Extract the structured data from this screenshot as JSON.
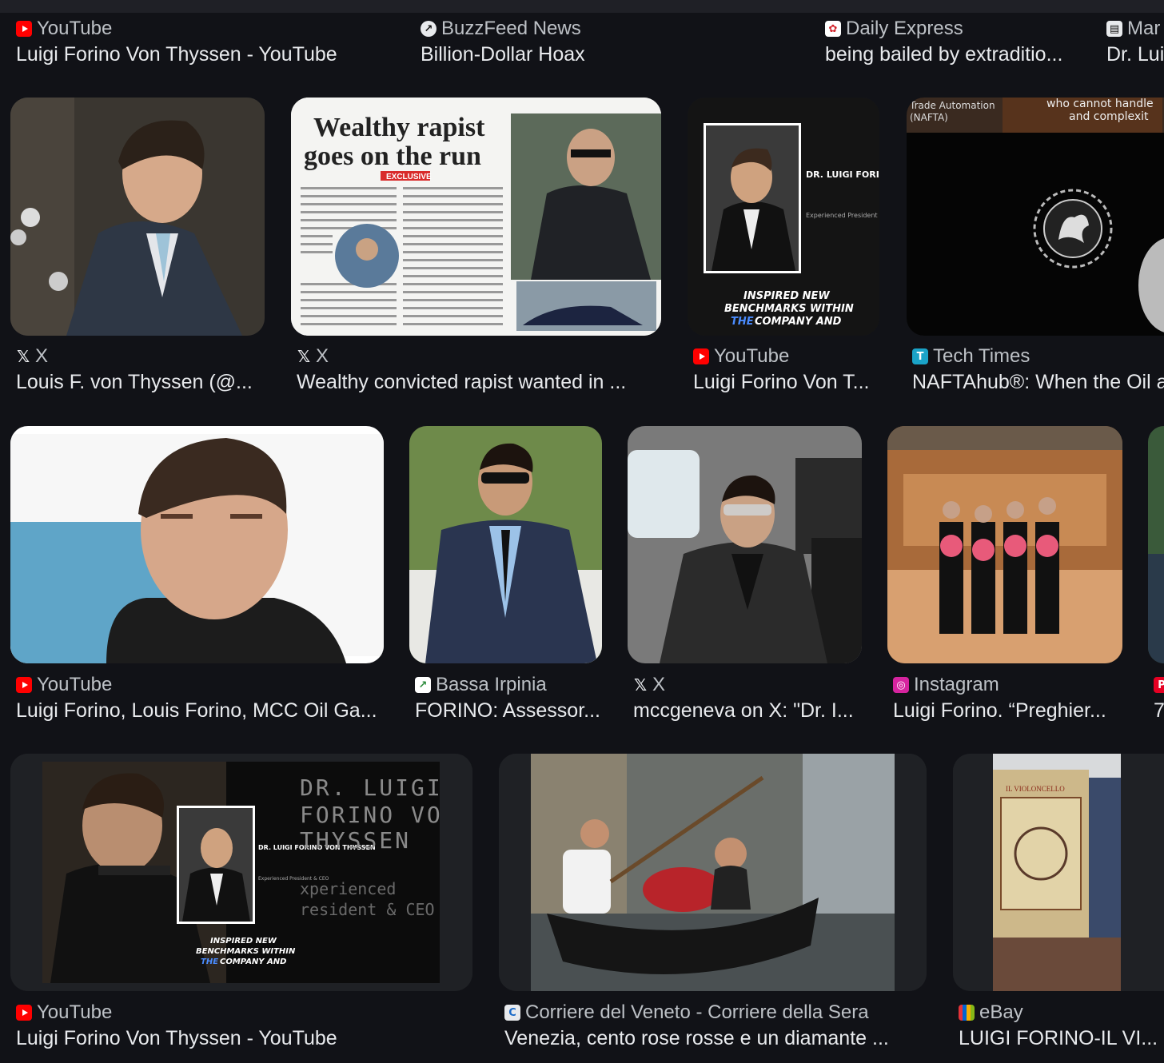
{
  "results": [
    {
      "source": "YouTube",
      "title": "Luigi Forino Von Thyssen - YouTube",
      "icon": "youtube-icon"
    },
    {
      "source": "BuzzFeed News",
      "title": "Billion-Dollar Hoax",
      "icon": "buzzfeed-icon"
    },
    {
      "source": "Daily Express",
      "title": "being bailed by extraditio...",
      "icon": "daily-express-icon"
    },
    {
      "source": "Mar",
      "title": "Dr. Lui",
      "icon": "newspaper-icon"
    },
    {
      "source": "X",
      "title": "Louis F. von Thyssen (@...",
      "icon": "x-icon"
    },
    {
      "source": "X",
      "title": "Wealthy convicted rapist wanted in ...",
      "icon": "x-icon",
      "image_text": {
        "headline1": "Wealthy rapist",
        "headline2": "goes on the run",
        "label": "EXCLUSIVE"
      }
    },
    {
      "source": "YouTube",
      "title": "Luigi Forino Von T...",
      "icon": "youtube-icon",
      "image_text": {
        "name": "DR. LUIGI FORINO VON THYSSEN",
        "role": "Experienced President & CEO",
        "tag1": "INSPIRED NEW",
        "tag2": "BENCHMARKS WITHIN",
        "tag3a": "THE",
        "tag3b": "COMPANY AND"
      }
    },
    {
      "source": "Tech Times",
      "title": "NAFTAhub®: When the Oil a",
      "icon": "tech-times-icon",
      "image_text": {
        "left": "Trade Automation",
        "left2": "(NAFTA)",
        "right": "who cannot handle",
        "right2": "and complexit"
      }
    },
    {
      "source": "YouTube",
      "title": "Luigi Forino, Louis Forino, MCC Oil Ga...",
      "icon": "youtube-icon"
    },
    {
      "source": "Bassa Irpinia",
      "title": "FORINO: Assessor...",
      "icon": "bassa-irpinia-icon"
    },
    {
      "source": "X",
      "title": "mccgeneva on X: \"Dr. I...",
      "icon": "x-icon"
    },
    {
      "source": "Instagram",
      "title": "Luigi Forino. “Preghier...",
      "icon": "instagram-icon"
    },
    {
      "source": "",
      "title": "7",
      "icon": "pinterest-icon"
    },
    {
      "source": "YouTube",
      "title": "Luigi Forino Von Thyssen - YouTube",
      "icon": "youtube-icon",
      "image_text": {
        "big1": "DR. LUIGI",
        "big2": "FORINO VO",
        "big3": "THYSSEN",
        "big4": "xperienced",
        "big5": "resident & CEO"
      }
    },
    {
      "source": "Corriere del Veneto - Corriere della Sera",
      "title": "Venezia, cento rose rosse e un diamante ...",
      "icon": "corriere-icon"
    },
    {
      "source": "eBay",
      "title": "LUIGI FORINO-IL VI...",
      "icon": "ebay-icon",
      "image_text": {
        "book": "IL VIOLONCELLO"
      }
    }
  ]
}
